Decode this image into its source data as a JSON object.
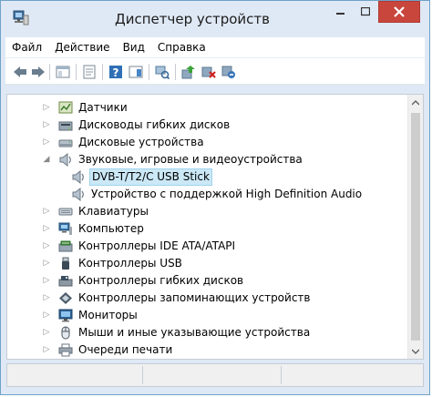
{
  "window": {
    "title": "Диспетчер устройств",
    "controls": {
      "minimize": "–",
      "maximize": "□",
      "close": "✕"
    }
  },
  "menu": [
    "Файл",
    "Действие",
    "Вид",
    "Справка"
  ],
  "toolbar": {
    "buttons": [
      "back-icon",
      "forward-icon",
      "console-tree-icon",
      "properties-icon",
      "help-icon",
      "show-hide-icon",
      "scan-hardware-icon",
      "update-driver-icon",
      "uninstall-icon",
      "disable-icon"
    ]
  },
  "tree": {
    "items": [
      {
        "label": "Датчики",
        "expander": "▷",
        "icon": "sensor-icon"
      },
      {
        "label": "Дисководы гибких дисков",
        "expander": "▷",
        "icon": "floppy-drive-icon"
      },
      {
        "label": "Дисковые устройства",
        "expander": "▷",
        "icon": "disk-drive-icon"
      },
      {
        "label": "Звуковые, игровые и видеоустройства",
        "expander": "◢",
        "icon": "speaker-icon"
      },
      {
        "label": "DVB-T/T2/C USB Stick",
        "expander": "",
        "icon": "speaker-icon",
        "selected": true
      },
      {
        "label": "Устройство с поддержкой High Definition Audio",
        "expander": "",
        "icon": "speaker-icon"
      },
      {
        "label": "Клавиатуры",
        "expander": "▷",
        "icon": "keyboard-icon"
      },
      {
        "label": "Компьютер",
        "expander": "▷",
        "icon": "computer-icon"
      },
      {
        "label": "Контроллеры IDE ATA/ATAPI",
        "expander": "▷",
        "icon": "ide-controller-icon"
      },
      {
        "label": "Контроллеры USB",
        "expander": "▷",
        "icon": "usb-icon"
      },
      {
        "label": "Контроллеры гибких дисков",
        "expander": "▷",
        "icon": "floppy-controller-icon"
      },
      {
        "label": "Контроллеры запоминающих устройств",
        "expander": "▷",
        "icon": "storage-controller-icon"
      },
      {
        "label": "Мониторы",
        "expander": "▷",
        "icon": "monitor-icon"
      },
      {
        "label": "Мыши и иные указывающие устройства",
        "expander": "▷",
        "icon": "mouse-icon"
      },
      {
        "label": "Очереди печати",
        "expander": "▷",
        "icon": "printer-icon"
      }
    ]
  },
  "scrollbar": {
    "up": "▲",
    "down": "▼"
  }
}
